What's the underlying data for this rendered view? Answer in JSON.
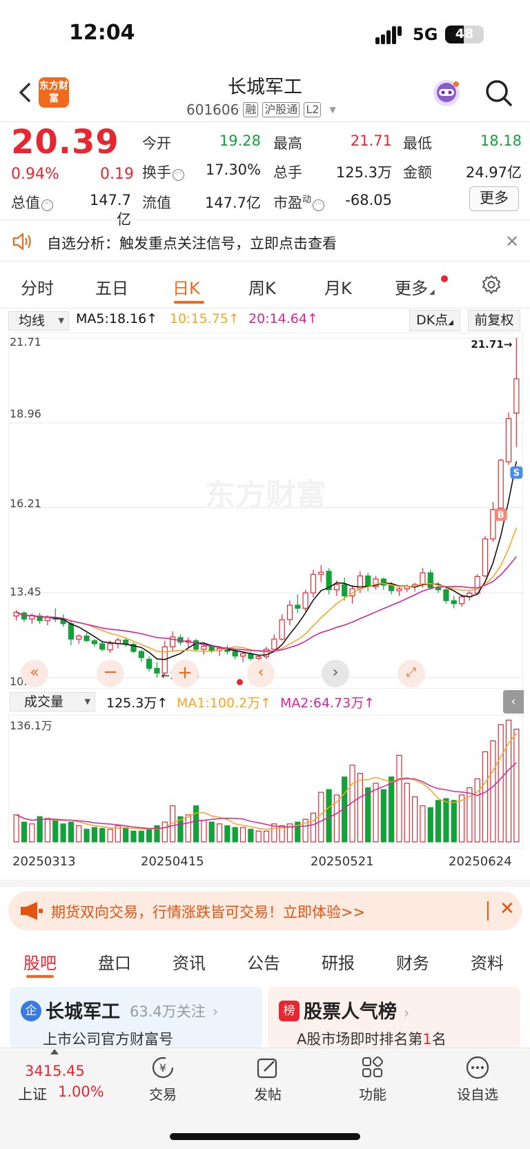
{
  "status_bar": {
    "time": "12:04",
    "network": "5G",
    "battery": "48"
  },
  "header": {
    "logo": "东方财富",
    "name": "长城军工",
    "code": "601606",
    "tags": [
      "融",
      "沪股通",
      "L2"
    ]
  },
  "quote": {
    "price": "20.39",
    "change_pct": "0.94%",
    "change": "0.19",
    "market_value_label": "总值",
    "market_value": "147.7亿",
    "rows": [
      [
        {
          "label": "今开",
          "value": "19.28",
          "color": "green"
        },
        {
          "label": "最高",
          "value": "21.71",
          "color": "red"
        },
        {
          "label": "最低",
          "value": "18.18",
          "color": "green"
        }
      ],
      [
        {
          "label": "换手",
          "value": "17.30%",
          "color": "dark"
        },
        {
          "label": "总手",
          "value": "125.3万",
          "color": "dark"
        },
        {
          "label": "金额",
          "value": "24.97亿",
          "color": "dark"
        }
      ],
      [
        {
          "label": "流值",
          "value": "147.7亿",
          "color": "dark"
        },
        {
          "label": "市盈",
          "value": "-68.05",
          "color": "dark"
        }
      ]
    ],
    "pe_superscript": "动",
    "more_label": "更多"
  },
  "notice": {
    "text": "自选分析：触发重点关注信号，立即点击查看"
  },
  "chart_tabs": [
    "分时",
    "五日",
    "日K",
    "周K",
    "月K",
    "更多"
  ],
  "chart_header": {
    "ma_select": "均线",
    "ma5": "MA5:18.16",
    "ma10": "10:15.75",
    "ma20": "20:14.64",
    "dk_label": "DK点",
    "adjust_label": "前复权",
    "colors": {
      "ma5": "#111111",
      "ma10": "#f5a623",
      "ma20": "#d6249f",
      "up": "#e8262f",
      "down": "#13a23a"
    }
  },
  "chart_data": {
    "type": "candlestick",
    "y_ticks": [
      "21.71",
      "18.96",
      "16.21",
      "13.45",
      "10.70"
    ],
    "ylim": [
      10.7,
      21.71
    ],
    "high_marker": "21.71→",
    "low_marker": "←10.70",
    "watermark": "东方财富",
    "ohlc": [
      [
        12.7,
        12.9,
        12.55,
        12.82
      ],
      [
        12.8,
        12.85,
        12.5,
        12.6
      ],
      [
        12.6,
        12.78,
        12.45,
        12.72
      ],
      [
        12.7,
        12.8,
        12.45,
        12.55
      ],
      [
        12.55,
        12.72,
        12.4,
        12.65
      ],
      [
        12.65,
        12.95,
        12.5,
        12.6
      ],
      [
        12.6,
        12.75,
        12.35,
        12.45
      ],
      [
        12.45,
        12.55,
        11.75,
        11.95
      ],
      [
        11.95,
        12.1,
        11.8,
        12.05
      ],
      [
        12.05,
        12.15,
        11.85,
        11.9
      ],
      [
        11.9,
        11.95,
        11.7,
        11.8
      ],
      [
        11.8,
        11.9,
        11.55,
        11.62
      ],
      [
        11.6,
        11.9,
        11.5,
        11.8
      ],
      [
        11.8,
        12.0,
        11.65,
        11.92
      ],
      [
        11.92,
        11.98,
        11.7,
        11.78
      ],
      [
        11.78,
        11.85,
        11.5,
        11.55
      ],
      [
        11.55,
        11.6,
        11.2,
        11.35
      ],
      [
        11.3,
        11.4,
        10.9,
        11.0
      ],
      [
        11.0,
        11.2,
        10.7,
        10.85
      ],
      [
        10.85,
        11.9,
        10.75,
        11.7
      ],
      [
        11.7,
        12.2,
        11.55,
        12.02
      ],
      [
        12.0,
        12.1,
        11.75,
        11.85
      ],
      [
        11.85,
        12.0,
        11.65,
        11.9
      ],
      [
        11.9,
        11.95,
        11.55,
        11.62
      ],
      [
        11.62,
        11.8,
        11.45,
        11.72
      ],
      [
        11.72,
        11.78,
        11.5,
        11.58
      ],
      [
        11.58,
        11.7,
        11.4,
        11.65
      ],
      [
        11.65,
        11.75,
        11.45,
        11.55
      ],
      [
        11.55,
        11.62,
        11.3,
        11.4
      ],
      [
        11.4,
        11.55,
        11.2,
        11.48
      ],
      [
        11.48,
        11.55,
        11.25,
        11.32
      ],
      [
        11.32,
        11.45,
        11.1,
        11.38
      ],
      [
        11.38,
        11.7,
        11.3,
        11.62
      ],
      [
        11.62,
        12.1,
        11.55,
        11.95
      ],
      [
        11.95,
        12.75,
        11.9,
        12.58
      ],
      [
        12.58,
        13.2,
        12.4,
        13.05
      ],
      [
        13.05,
        13.4,
        12.8,
        12.95
      ],
      [
        12.95,
        13.55,
        12.85,
        13.45
      ],
      [
        13.45,
        14.2,
        13.3,
        14.05
      ],
      [
        14.05,
        14.35,
        13.8,
        14.12
      ],
      [
        14.15,
        14.25,
        13.4,
        13.55
      ],
      [
        13.55,
        13.85,
        13.35,
        13.72
      ],
      [
        13.72,
        13.95,
        13.2,
        13.35
      ],
      [
        13.35,
        13.7,
        13.1,
        13.58
      ],
      [
        13.58,
        14.15,
        13.45,
        14.0
      ],
      [
        14.0,
        14.1,
        13.5,
        13.65
      ],
      [
        13.65,
        14.0,
        13.55,
        13.9
      ],
      [
        13.9,
        13.95,
        13.55,
        13.7
      ],
      [
        13.7,
        13.8,
        13.4,
        13.52
      ],
      [
        13.52,
        13.68,
        13.35,
        13.58
      ],
      [
        13.58,
        13.72,
        13.48,
        13.66
      ],
      [
        13.66,
        13.78,
        13.5,
        13.72
      ],
      [
        13.72,
        14.25,
        13.62,
        14.1
      ],
      [
        14.1,
        14.2,
        13.55,
        13.62
      ],
      [
        13.62,
        13.8,
        13.45,
        13.55
      ],
      [
        13.55,
        13.62,
        13.1,
        13.2
      ],
      [
        13.2,
        13.35,
        12.95,
        13.1
      ],
      [
        13.1,
        13.4,
        13.0,
        13.32
      ],
      [
        13.32,
        13.5,
        13.2,
        13.44
      ],
      [
        13.44,
        14.05,
        13.38,
        13.98
      ],
      [
        14.0,
        15.3,
        13.95,
        15.2
      ],
      [
        15.2,
        16.4,
        15.1,
        16.15
      ],
      [
        16.2,
        17.8,
        16.1,
        17.75
      ],
      [
        17.7,
        19.3,
        17.6,
        19.1
      ],
      [
        19.28,
        21.71,
        18.18,
        20.39
      ]
    ],
    "ma_lines_count": 3
  },
  "volume": {
    "select": "成交量",
    "value": "125.3万",
    "ma1": "MA1:100.2万",
    "ma2": "MA2:64.73万",
    "max_label": "136.1万",
    "values": [
      30,
      22,
      20,
      28,
      26,
      25,
      20,
      22,
      18,
      14,
      16,
      15,
      14,
      18,
      16,
      12,
      12,
      14,
      18,
      22,
      40,
      28,
      30,
      40,
      24,
      22,
      20,
      18,
      16,
      16,
      14,
      12,
      12,
      20,
      18,
      20,
      22,
      25,
      32,
      55,
      58,
      52,
      72,
      85,
      76,
      60,
      65,
      58,
      72,
      96,
      65,
      50,
      40,
      38,
      46,
      48,
      46,
      52,
      60,
      70,
      100,
      112,
      130,
      135,
      125
    ],
    "dates": [
      "20250313",
      "20250415",
      "20250521",
      "20250624"
    ]
  },
  "promo": {
    "text": "期货双向交易，行情涨跌皆可交易！立即体验>>"
  },
  "bottom_tabs": [
    "股吧",
    "盘口",
    "资讯",
    "公告",
    "研报",
    "财务",
    "资料"
  ],
  "cards": [
    {
      "icon": "企",
      "title": "长城军工",
      "sub": "63.4万关注",
      "desc": "上市公司官方财富号"
    },
    {
      "icon": "榜",
      "title": "股票人气榜",
      "sub": "",
      "desc_prefix": "A股市场即时排名第",
      "desc_rank": "1",
      "desc_suffix": "名"
    }
  ],
  "bottom_nav": {
    "index_value": "3415.45",
    "index_name": "上证",
    "index_pct": "1.00%",
    "items": [
      "交易",
      "发帖",
      "功能",
      "设自选"
    ]
  }
}
